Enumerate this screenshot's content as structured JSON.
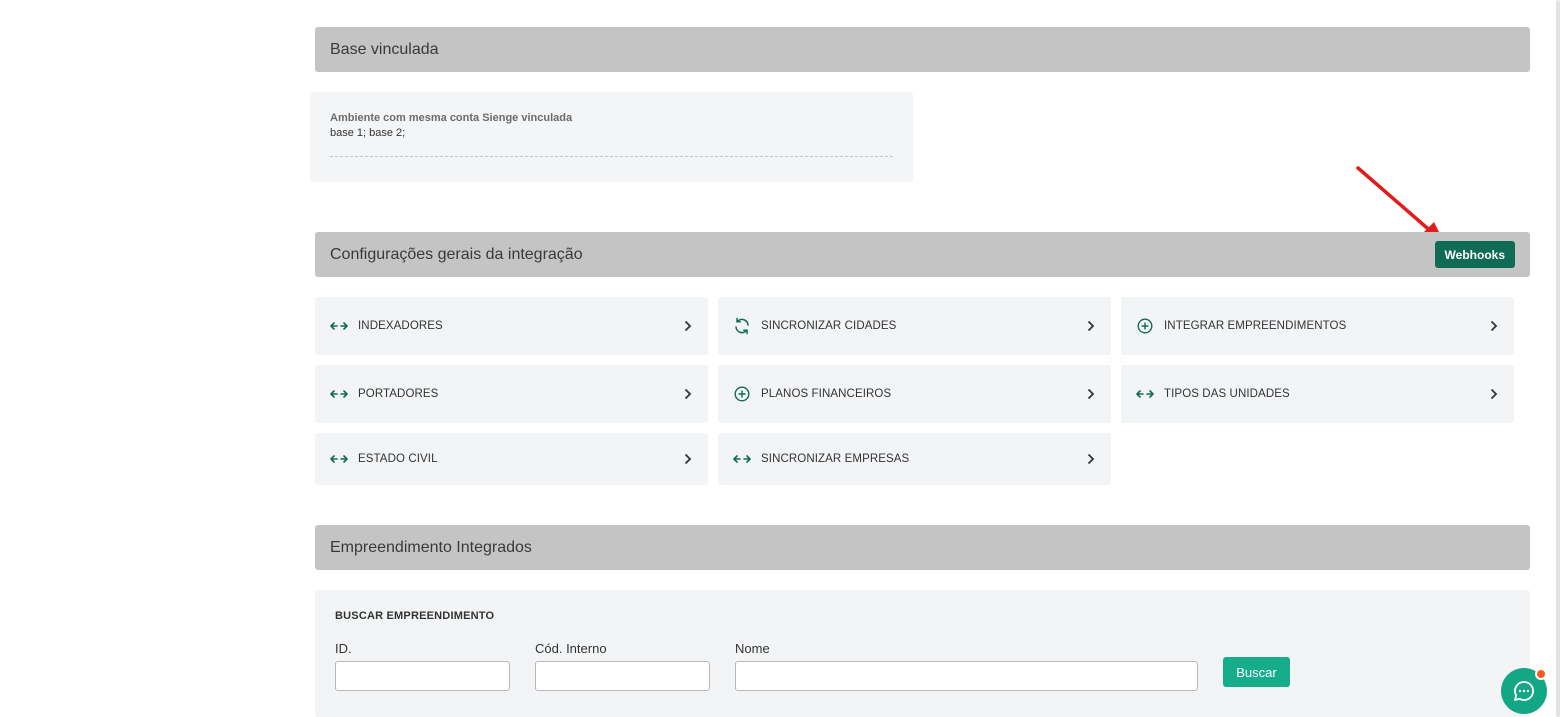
{
  "sections": {
    "base_vinculada": {
      "title": "Base vinculada",
      "label": "Ambiente com mesma conta Sienge vinculada",
      "value": "base 1; base 2;"
    },
    "configuracoes": {
      "title": "Configurações gerais da integração",
      "webhooks_label": "Webhooks",
      "tiles": [
        {
          "label": "INDEXADORES",
          "icon": "arrows-horizontal-icon"
        },
        {
          "label": "SINCRONIZAR CIDADES",
          "icon": "sync-icon"
        },
        {
          "label": "INTEGRAR EMPREENDIMENTOS",
          "icon": "plus-circle-icon"
        },
        {
          "label": "PORTADORES",
          "icon": "arrows-horizontal-icon"
        },
        {
          "label": "PLANOS FINANCEIROS",
          "icon": "plus-circle-icon"
        },
        {
          "label": "TIPOS DAS UNIDADES",
          "icon": "arrows-horizontal-icon"
        },
        {
          "label": "ESTADO CIVIL",
          "icon": "arrows-horizontal-icon"
        },
        {
          "label": "SINCRONIZAR EMPRESAS",
          "icon": "arrows-horizontal-icon"
        }
      ]
    },
    "empreendimentos": {
      "title": "Empreendimento Integrados",
      "search_title": "BUSCAR EMPREENDIMENTO",
      "fields": {
        "id_label": "ID.",
        "id_value": "",
        "codigo_label": "Cód. Interno",
        "codigo_value": "",
        "nome_label": "Nome",
        "nome_value": ""
      },
      "buscar_label": "Buscar"
    }
  },
  "colors": {
    "header_bg": "#c4c4c4",
    "accent_dark": "#0f6b53",
    "accent": "#16ad8a",
    "annotation_arrow": "#e21b1b"
  }
}
